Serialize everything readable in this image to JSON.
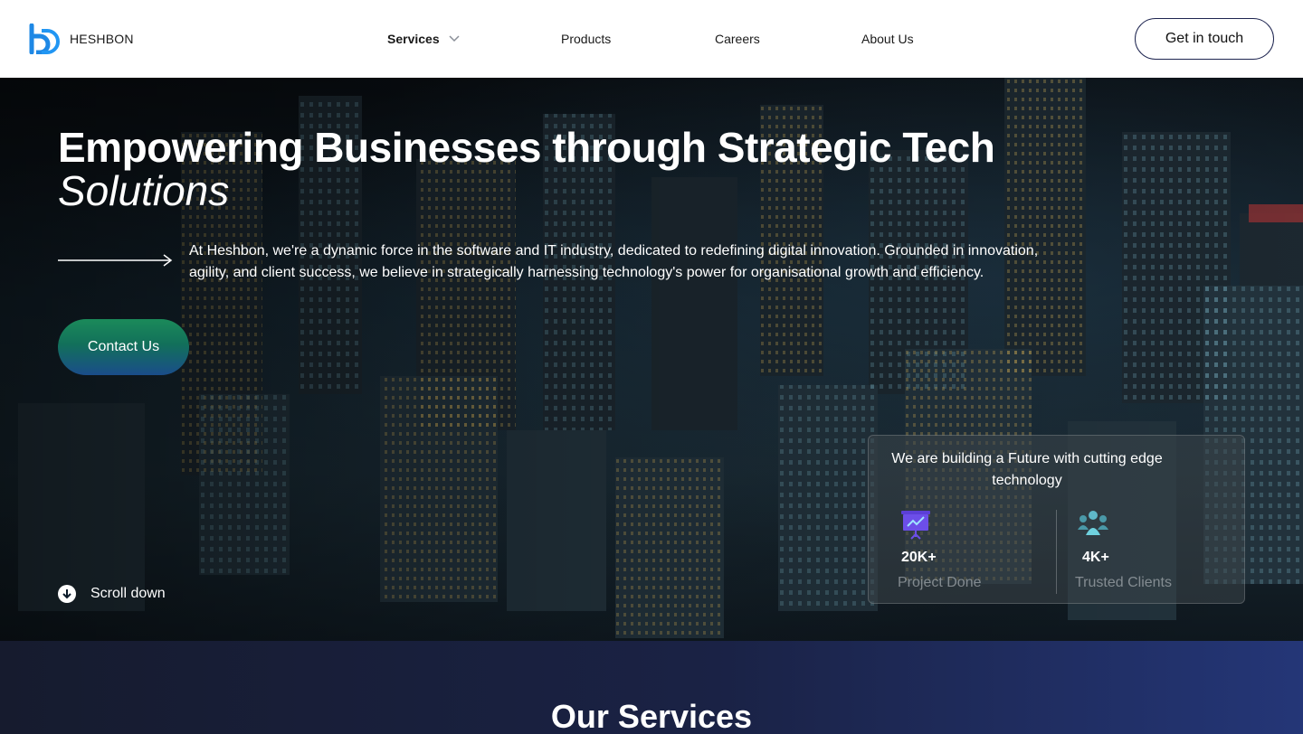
{
  "header": {
    "brand": "HESHBON",
    "nav": {
      "services": "Services",
      "products": "Products",
      "careers": "Careers",
      "about": "About Us"
    },
    "cta": "Get in touch"
  },
  "hero": {
    "title": "Empowering Businesses through Strategic Tech",
    "title_italic": "Solutions",
    "description": "At Heshbon, we're a dynamic force in the software and IT industry, dedicated to redefining digital innovation. Grounded in innovation, agility, and client success, we believe in strategically harnessing technology's power for organisational growth and efficiency.",
    "contact_button": "Contact Us",
    "scroll_label": "Scroll down"
  },
  "stats": {
    "heading": "We are building a Future with cutting edge technology",
    "items": [
      {
        "value": "20K+",
        "label": "Project Done",
        "icon": "presentation-chart-icon"
      },
      {
        "value": "4K+",
        "label": "Trusted Clients",
        "icon": "users-group-icon"
      }
    ]
  },
  "services": {
    "title": "Our Services"
  },
  "colors": {
    "brand_blue": "#1e88e5",
    "cta_border": "#1e2550",
    "contact_gradient_top": "#1b8a5a",
    "contact_gradient_bottom": "#1a4d8a",
    "services_bg": "#1a2245"
  }
}
